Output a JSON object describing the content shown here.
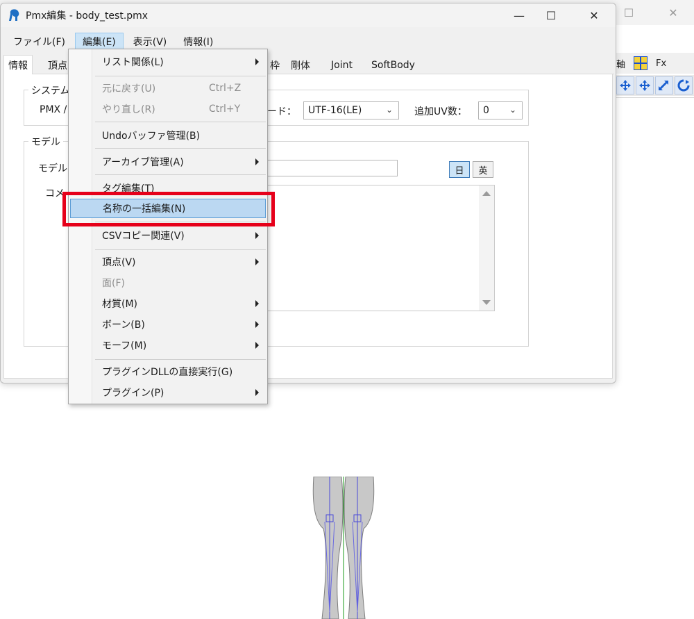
{
  "window": {
    "title": "Pmx編集 - body_test.pmx",
    "minimize": "—",
    "maximize": "☐",
    "close": "✕"
  },
  "background_window": {
    "maximize": "☐",
    "close": "✕",
    "axis_label": "軸",
    "fx_label": "Fx"
  },
  "menubar": {
    "file": "ファイル(F)",
    "edit": "編集(E)",
    "view": "表示(V)",
    "info": "情報(I)"
  },
  "tabs": {
    "info": "情報",
    "vertex": "頂点",
    "frame": "枠",
    "rigid": "剛体",
    "joint": "Joint",
    "softbody": "SoftBody"
  },
  "info_panel": {
    "system_group": "システム",
    "pmx_label": "PMX /",
    "encode_label": "ード：",
    "encode_value": "UTF-16(LE)",
    "uv_label": "追加UV数：",
    "uv_value": "0",
    "model_group": "モデル",
    "model_name_label": "モデル名",
    "comment_label": "コメ",
    "lang_jp": "日",
    "lang_en": "英"
  },
  "edit_menu": {
    "items": [
      {
        "label": "リスト関係(L)"
      },
      {
        "label": "元に戻す(U)",
        "shortcut": "Ctrl+Z"
      },
      {
        "label": "やり直し(R)",
        "shortcut": "Ctrl+Y"
      },
      {
        "label": "Undoバッファ管理(B)"
      },
      {
        "label": "アーカイブ管理(A)"
      },
      {
        "label": "タグ編集(T)"
      },
      {
        "label": "名称の一括編集(N)"
      },
      {
        "label": "CSVコピー関連(V)"
      },
      {
        "label": "頂点(V)"
      },
      {
        "label": "面(F)"
      },
      {
        "label": "材質(M)"
      },
      {
        "label": "ボーン(B)"
      },
      {
        "label": "モーフ(M)"
      },
      {
        "label": "プラグインDLLの直接実行(G)"
      },
      {
        "label": "プラグイン(P)"
      }
    ]
  },
  "colors": {
    "highlight_box": "#e6001a",
    "menu_highlight": "#bbd8f2"
  }
}
